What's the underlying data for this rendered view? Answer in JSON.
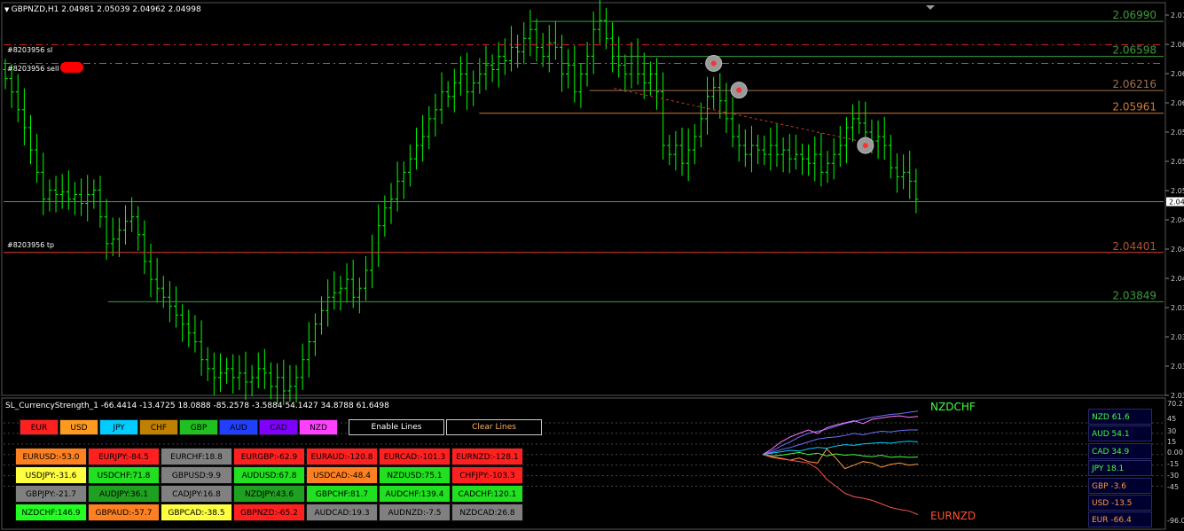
{
  "header": {
    "symbol_info": "GBPNZD,H1  2.04981 2.05039 2.04962 2.04998"
  },
  "colors": {
    "bull": "#00ff00",
    "bear": "#00ff00",
    "level_green": "#3c9b3c",
    "level_orange": "#d07a3a",
    "sl_tp": "#e02020",
    "sell_line": "#22aa22",
    "current_price": "#708090",
    "grid": "#333"
  },
  "trade_labels": {
    "sl": "#8203956 sl",
    "sell": "#8203956 sell",
    "tp": "#8203956 tp"
  },
  "chart_data": [
    {
      "type": "candlestick",
      "symbol": "GBPNZD",
      "timeframe": "H1",
      "ylim": [
        2.028,
        2.072
      ],
      "price_axis_ticks": [
        "2.07",
        "2.06",
        "2.06",
        "2.06",
        "2.05",
        "2.05",
        "2.05",
        "2.04",
        "2.04",
        "2.04",
        "2.03",
        "2.03",
        "2.03",
        "2.03"
      ],
      "current_price_label": "2.04",
      "levels": [
        {
          "label": "2.06990",
          "value": 2.0699,
          "x_start": 0.455,
          "color": "green"
        },
        {
          "label": "2.06598",
          "value": 2.06598,
          "x_start": 0.53,
          "color": "green"
        },
        {
          "label": "2.06216",
          "value": 2.06216,
          "x_start": 0.505,
          "color": "orange_dim"
        },
        {
          "label": "2.05961",
          "value": 2.05961,
          "x_start": 0.41,
          "color": "orange"
        },
        {
          "label": "2.04401",
          "value": 2.04401,
          "x_start": 0.0,
          "color": "red_dim"
        },
        {
          "label": "2.03849",
          "value": 2.03849,
          "x_start": 0.09,
          "color": "green"
        }
      ],
      "stop_loss": 2.0673,
      "sell_entry": 2.0652,
      "take_profit": 2.044,
      "current_price": 2.0497,
      "closes": [
        2.0635,
        2.062,
        2.06,
        2.058,
        2.0555,
        2.053,
        2.05,
        2.051,
        2.0505,
        2.0508,
        2.05,
        2.0505,
        2.0495,
        2.0505,
        2.051,
        2.048,
        2.045,
        2.0455,
        2.0465,
        2.0475,
        2.048,
        2.046,
        2.043,
        2.041,
        2.04,
        2.039,
        2.038,
        2.037,
        2.036,
        2.035,
        2.034,
        2.032,
        2.031,
        2.03,
        2.0305,
        2.031,
        2.03,
        2.0305,
        2.0295,
        2.03,
        2.031,
        2.0305,
        2.029,
        2.03,
        2.0285,
        2.029,
        2.03,
        2.032,
        2.034,
        2.036,
        2.0375,
        2.039,
        2.0395,
        2.04,
        2.041,
        2.039,
        2.04,
        2.042,
        2.044,
        2.047,
        2.049,
        2.05,
        2.052,
        2.053,
        2.0545,
        2.056,
        2.057,
        2.059,
        2.06,
        2.062,
        2.0615,
        2.063,
        2.064,
        2.062,
        2.063,
        2.064,
        2.065,
        2.0645,
        2.066,
        2.0655,
        2.067,
        2.0665,
        2.068,
        2.069,
        2.067,
        2.066,
        2.0675,
        2.067,
        2.064,
        2.065,
        2.062,
        2.064,
        2.066,
        2.069,
        2.07,
        2.068,
        2.066,
        2.065,
        2.064,
        2.066,
        2.064,
        2.063,
        2.064,
        2.062,
        2.056,
        2.055,
        2.056,
        2.054,
        2.0555,
        2.057,
        2.059,
        2.0615,
        2.0625,
        2.061,
        2.059,
        2.057,
        2.056,
        2.055,
        2.056,
        2.0555,
        2.055,
        2.056,
        2.055,
        2.0555,
        2.0545,
        2.055,
        2.0545,
        2.054,
        2.055,
        2.053,
        2.054,
        2.055,
        2.056,
        2.058,
        2.059,
        2.0585,
        2.0575,
        2.0565,
        2.057,
        2.056,
        2.0535,
        2.0525,
        2.053,
        2.052,
        2.05
      ]
    },
    {
      "type": "line",
      "indicator_title": "SL_CurrencyStrength_1 -66.4414 -13.4725 18.0888 -85.2578 -3.5884 54.1427 34.8788 61.6498",
      "ylim": [
        -96.0,
        70.2
      ],
      "y_ticks": [
        "70.2",
        "45",
        "30",
        "15",
        "0.00",
        "-15",
        "-30",
        "-45",
        "-96.0"
      ],
      "top_pair_label": "NZDCHF",
      "bottom_pair_label": "EURNZD",
      "series": [
        {
          "name": "NZD",
          "color": "#6f6fff",
          "values": [
            0,
            5,
            12,
            18,
            25,
            30,
            33,
            36,
            40,
            44,
            47,
            50,
            53,
            55,
            57,
            58,
            60,
            61.6
          ]
        },
        {
          "name": "AUD",
          "color": "#ff77ff",
          "values": [
            0,
            8,
            18,
            25,
            30,
            35,
            30,
            38,
            42,
            45,
            48,
            44,
            50,
            52,
            54,
            55,
            53,
            54.1
          ]
        },
        {
          "name": "CAD",
          "color": "#6f6fff",
          "values": [
            0,
            3,
            7,
            10,
            14,
            18,
            22,
            24,
            25,
            27,
            30,
            28,
            31,
            33,
            32,
            34,
            35,
            34.9
          ]
        },
        {
          "name": "JPY",
          "color": "#00d0ff",
          "values": [
            0,
            2,
            4,
            6,
            5,
            8,
            10,
            9,
            12,
            14,
            13,
            15,
            16,
            17,
            16,
            18,
            19,
            18.1
          ]
        },
        {
          "name": "GBP",
          "color": "#40ff40",
          "values": [
            0,
            -2,
            -1,
            1,
            3,
            0,
            2,
            -2,
            1,
            -1,
            0,
            -2,
            -3,
            -1,
            -4,
            -3,
            -4,
            -3.6
          ]
        },
        {
          "name": "USD",
          "color": "#ff9a40",
          "values": [
            0,
            -4,
            -6,
            -8,
            -5,
            -10,
            -12,
            8,
            -5,
            -20,
            -15,
            -10,
            -12,
            -18,
            -14,
            -12,
            -15,
            -13.5
          ]
        },
        {
          "name": "EUR",
          "color": "#ff5050",
          "values": [
            0,
            -3,
            -5,
            -8,
            -10,
            -12,
            -20,
            -35,
            -45,
            -55,
            -60,
            -62,
            -65,
            -70,
            -75,
            -78,
            -80,
            -85.3
          ]
        }
      ]
    }
  ],
  "currency_buttons": [
    {
      "label": "EUR",
      "color": "#ff2020"
    },
    {
      "label": "USD",
      "color": "#ff9a20"
    },
    {
      "label": "JPY",
      "color": "#00ccff"
    },
    {
      "label": "CHF",
      "color": "#c08000"
    },
    {
      "label": "GBP",
      "color": "#20c020"
    },
    {
      "label": "AUD",
      "color": "#2040ff"
    },
    {
      "label": "CAD",
      "color": "#8000ff"
    },
    {
      "label": "NZD",
      "color": "#ff40ff"
    }
  ],
  "controls": {
    "enable_lines": "Enable Lines",
    "clear_lines": "Clear Lines"
  },
  "pair_table": [
    [
      {
        "t": "EURUSD:-53.0",
        "c": "#ff8020"
      },
      {
        "t": "EURJPY:-84.5",
        "c": "#ff2020"
      },
      {
        "t": "EURCHF:18.8",
        "c": "#808080"
      },
      {
        "t": "EURGBP:-62.9",
        "c": "#ff2020"
      },
      {
        "t": "EURAUD:-120.8",
        "c": "#ff2020"
      },
      {
        "t": "EURCAD:-101.3",
        "c": "#ff2020"
      },
      {
        "t": "EURNZD:-128.1",
        "c": "#ff2020"
      }
    ],
    [
      {
        "t": "USDJPY:-31.6",
        "c": "#ffff40"
      },
      {
        "t": "USDCHF:71.8",
        "c": "#20e020"
      },
      {
        "t": "GBPUSD:9.9",
        "c": "#808080"
      },
      {
        "t": "AUDUSD:67.8",
        "c": "#20e020"
      },
      {
        "t": "USDCAD:-48.4",
        "c": "#ff8020"
      },
      {
        "t": "NZDUSD:75.1",
        "c": "#20e020"
      },
      {
        "t": "CHFJPY:-103.3",
        "c": "#ff2020"
      }
    ],
    [
      {
        "t": "GBPJPY:-21.7",
        "c": "#808080"
      },
      {
        "t": "AUDJPY:36.1",
        "c": "#20a020"
      },
      {
        "t": "CADJPY:16.8",
        "c": "#808080"
      },
      {
        "t": "NZDJPY:43.6",
        "c": "#20a020"
      },
      {
        "t": "GBPCHF:81.7",
        "c": "#20e020"
      },
      {
        "t": "AUDCHF:139.4",
        "c": "#20e020"
      },
      {
        "t": "CADCHF:120.1",
        "c": "#20e020"
      }
    ],
    [
      {
        "t": "NZDCHF:146.9",
        "c": "#20ff20"
      },
      {
        "t": "GBPAUD:-57.7",
        "c": "#ff8020"
      },
      {
        "t": "GBPCAD:-38.5",
        "c": "#ffff40"
      },
      {
        "t": "GBPNZD:-65.2",
        "c": "#ff2020"
      },
      {
        "t": "AUDCAD:19.3",
        "c": "#808080"
      },
      {
        "t": "AUDNZD:-7.5",
        "c": "#808080"
      },
      {
        "t": "NZDCAD:26.8",
        "c": "#808080"
      }
    ]
  ],
  "ranking": [
    {
      "label": "NZD  61.6",
      "color": "#40ff40"
    },
    {
      "label": "AUD  54.1",
      "color": "#40ff40"
    },
    {
      "label": "CAD  34.9",
      "color": "#40ff40"
    },
    {
      "label": "JPY  18.1",
      "color": "#40ff40"
    },
    {
      "label": "GBP  -3.6",
      "color": "#ff9a40"
    },
    {
      "label": "USD  -13.5",
      "color": "#ff9a40"
    },
    {
      "label": "EUR  -66.4",
      "color": "#ff9a40"
    }
  ]
}
